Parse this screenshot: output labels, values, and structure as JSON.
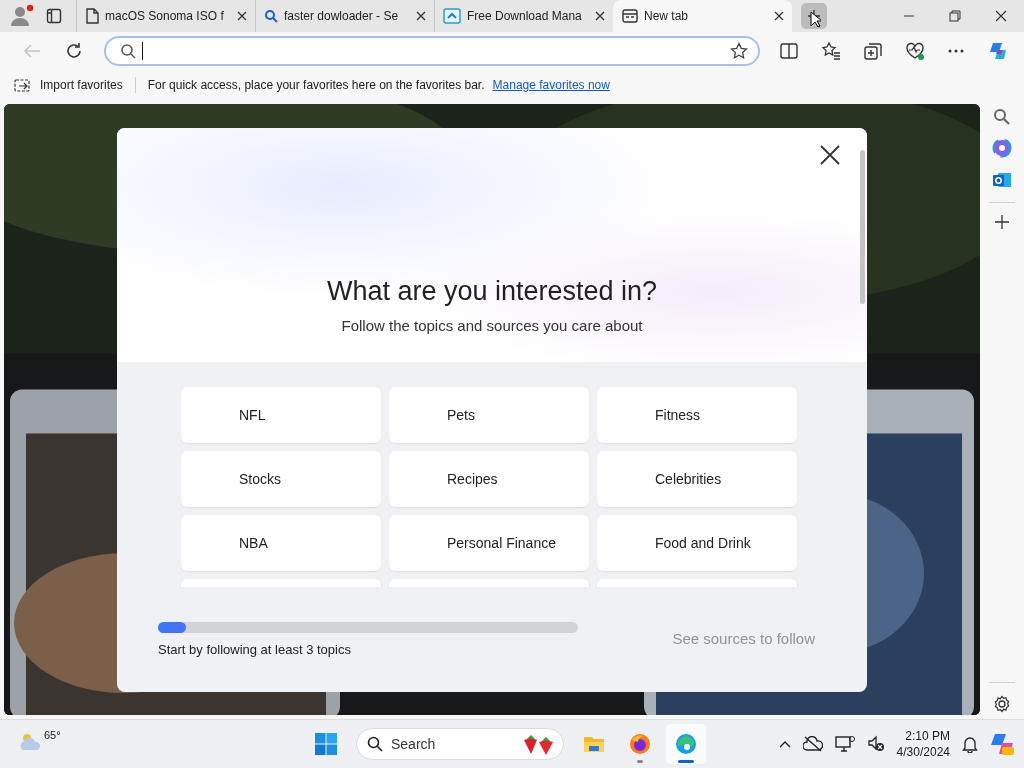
{
  "tabs": [
    {
      "kind": "page",
      "title": "macOS Sonoma ISO f",
      "selected": false
    },
    {
      "kind": "search",
      "title": "faster dowloader - Se",
      "selected": false
    },
    {
      "kind": "app",
      "title": "Free Download Mana",
      "selected": false
    },
    {
      "kind": "newtab",
      "title": "New tab",
      "selected": true
    }
  ],
  "address_bar": {
    "focused": true
  },
  "favorites_bar": {
    "import_label": "Import favorites",
    "message": "For quick access, place your favorites here on the favorites bar.",
    "link": "Manage favorites now"
  },
  "dialog": {
    "title": "What are you interested in?",
    "subtitle": "Follow the topics and sources you care about",
    "topics": [
      {
        "label": "NFL",
        "followed": false
      },
      {
        "label": "Pets",
        "followed": false
      },
      {
        "label": "Fitness",
        "followed": false
      },
      {
        "label": "Stocks",
        "followed": false
      },
      {
        "label": "Recipes",
        "followed": false
      },
      {
        "label": "Celebrities",
        "followed": false
      },
      {
        "label": "NBA",
        "followed": false
      },
      {
        "label": "Personal Finance",
        "followed": false
      },
      {
        "label": "Food and Drink",
        "followed": false
      }
    ],
    "more_rows_below": true,
    "progress": {
      "level": 0.067
    },
    "progress_label": "Start by following at least 3 topics",
    "next_button": {
      "label": "See sources to follow",
      "disabled": true
    }
  },
  "taskbar": {
    "weather": "65°",
    "search_placeholder": "Search",
    "apps": [
      {
        "kind": "explorer",
        "running": false,
        "selected": false
      },
      {
        "kind": "firefox",
        "running": true,
        "selected": false
      },
      {
        "kind": "edge",
        "running": true,
        "selected": true
      }
    ],
    "time": "2:10 PM",
    "date": "4/30/2024"
  }
}
